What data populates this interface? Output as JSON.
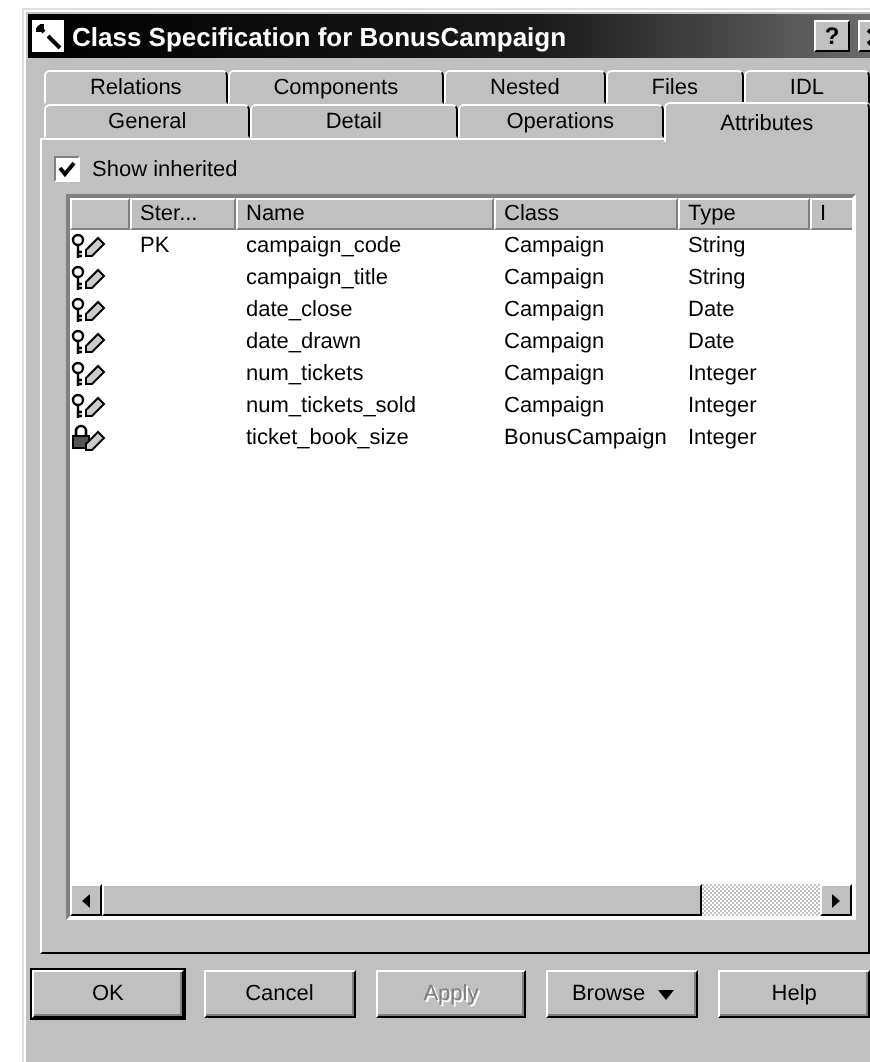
{
  "window": {
    "title": "Class Specification for BonusCampaign",
    "help": "?"
  },
  "tab_rows": [
    [
      {
        "label": "Relations",
        "selected": false
      },
      {
        "label": "Components",
        "selected": false
      },
      {
        "label": "Nested",
        "selected": false
      },
      {
        "label": "Files",
        "selected": false
      },
      {
        "label": "IDL",
        "selected": false
      }
    ],
    [
      {
        "label": "General",
        "selected": false
      },
      {
        "label": "Detail",
        "selected": false
      },
      {
        "label": "Operations",
        "selected": false
      },
      {
        "label": "Attributes",
        "selected": true
      }
    ]
  ],
  "show_inherited": {
    "label": "Show inherited",
    "checked": true
  },
  "table": {
    "columns": [
      "Ster...",
      "Name",
      "Class",
      "Type",
      "I"
    ],
    "rows": [
      {
        "kind": "public",
        "cells": [
          "PK",
          "campaign_code",
          "Campaign",
          "String"
        ]
      },
      {
        "kind": "public",
        "cells": [
          "",
          "campaign_title",
          "Campaign",
          "String"
        ]
      },
      {
        "kind": "public",
        "cells": [
          "",
          "date_close",
          "Campaign",
          "Date"
        ]
      },
      {
        "kind": "public",
        "cells": [
          "",
          "date_drawn",
          "Campaign",
          "Date"
        ]
      },
      {
        "kind": "public",
        "cells": [
          "",
          "num_tickets",
          "Campaign",
          "Integer"
        ]
      },
      {
        "kind": "public",
        "cells": [
          "",
          "num_tickets_sold",
          "Campaign",
          "Integer"
        ]
      },
      {
        "kind": "private",
        "cells": [
          "",
          "ticket_book_size",
          "BonusCampaign",
          "Integer"
        ]
      }
    ]
  },
  "buttons": [
    {
      "label": "OK",
      "default": true,
      "disabled": false,
      "dropdown": false
    },
    {
      "label": "Cancel",
      "default": false,
      "disabled": false,
      "dropdown": false
    },
    {
      "label": "Apply",
      "default": false,
      "disabled": true,
      "dropdown": false
    },
    {
      "label": "Browse",
      "dropdown": true,
      "default": false,
      "disabled": false
    },
    {
      "label": "Help",
      "default": false,
      "disabled": false,
      "dropdown": false
    }
  ]
}
